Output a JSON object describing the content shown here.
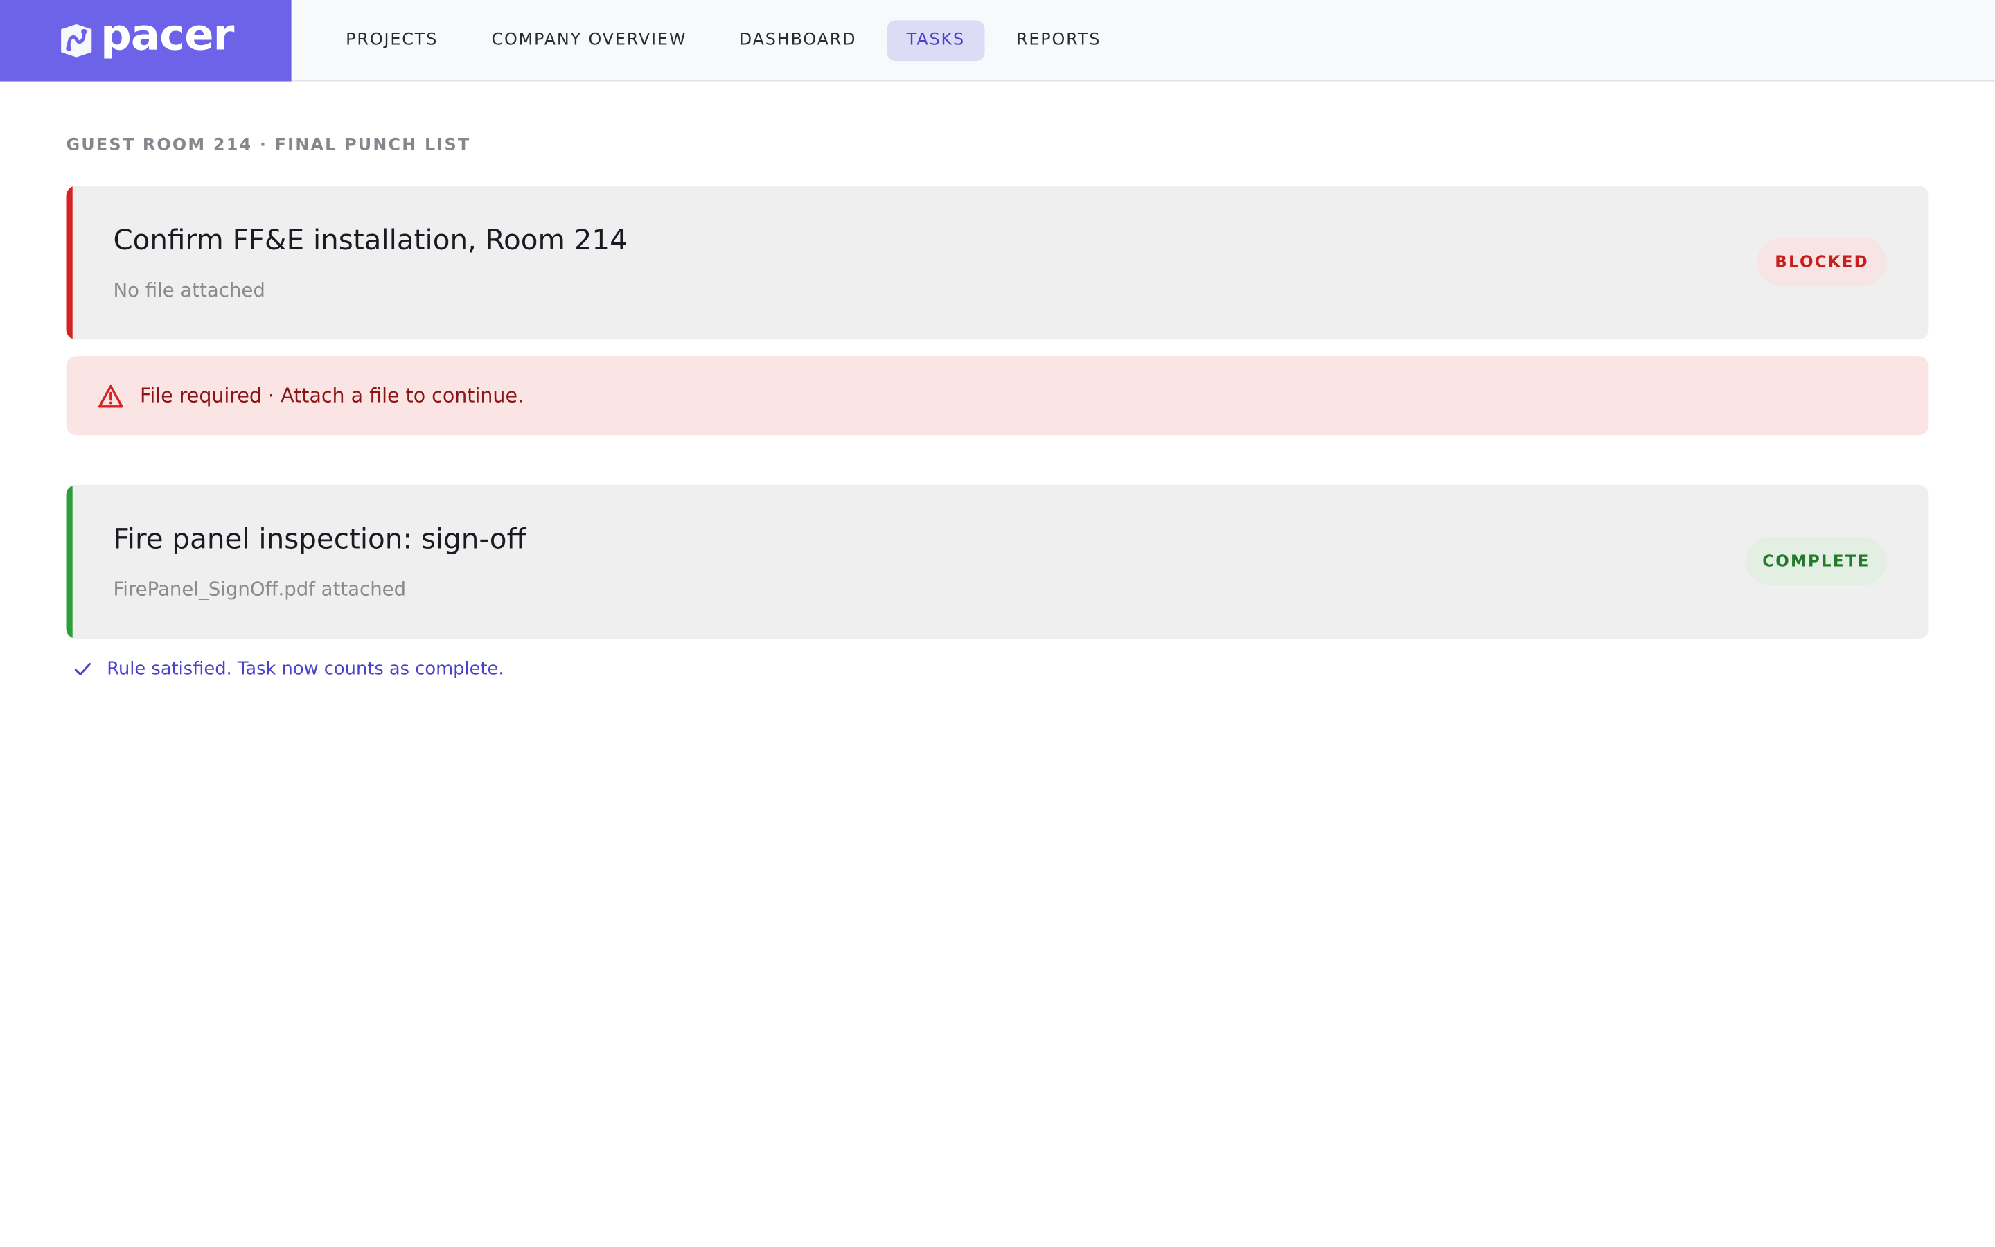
{
  "app": {
    "brand": "pacer",
    "colors": {
      "brand": "#6c63e8",
      "accent": "#4a40c9",
      "blocked": "#d92121",
      "complete": "#2e9e3a"
    }
  },
  "nav": {
    "items": [
      {
        "label": "PROJECTS",
        "active": false
      },
      {
        "label": "COMPANY OVERVIEW",
        "active": false
      },
      {
        "label": "DASHBOARD",
        "active": false
      },
      {
        "label": "TASKS",
        "active": true
      },
      {
        "label": "REPORTS",
        "active": false
      }
    ]
  },
  "page": {
    "section_title": "GUEST ROOM 214 · FINAL PUNCH LIST"
  },
  "tasks": [
    {
      "title": "Confirm FF&E installation, Room 214",
      "subtitle": "No file attached",
      "status": "BLOCKED",
      "status_color": "#d92121"
    },
    {
      "title": "Fire panel inspection: sign-off",
      "subtitle": "FirePanel_SignOff.pdf attached",
      "status": "COMPLETE",
      "status_color": "#2e9e3a"
    }
  ],
  "alert": {
    "icon": "warning-triangle-icon",
    "text": "File required · Attach a file to continue."
  },
  "success": {
    "icon": "checkmark-icon",
    "text": "Rule satisfied. Task now counts as complete."
  }
}
